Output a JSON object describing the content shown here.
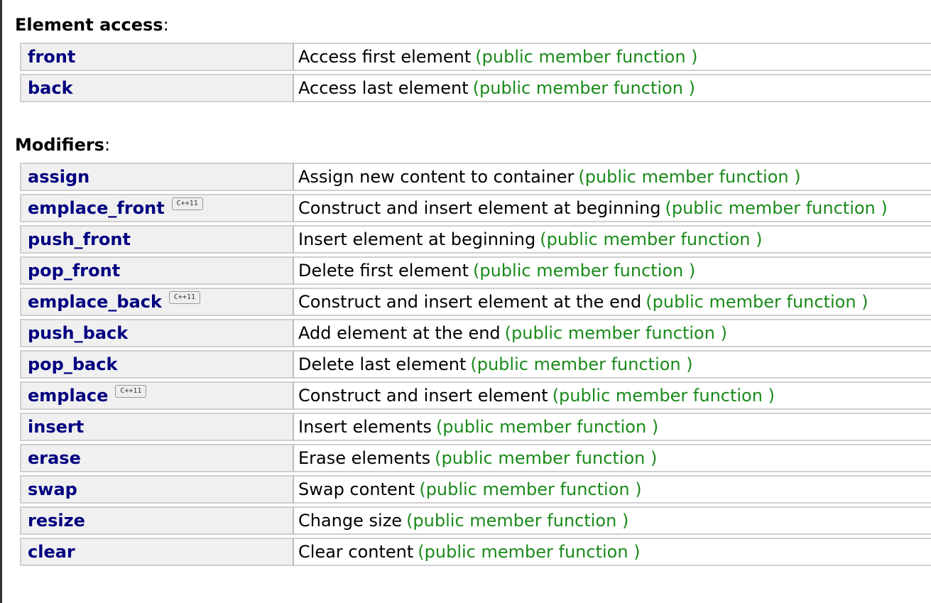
{
  "sections": [
    {
      "title": "Element access",
      "colon": ":",
      "rows": [
        {
          "name": "front",
          "description": "Access first element",
          "kind": "(public member function )",
          "badge": ""
        },
        {
          "name": "back",
          "description": "Access last element",
          "kind": "(public member function )",
          "badge": ""
        }
      ]
    },
    {
      "title": "Modifiers",
      "colon": ":",
      "rows": [
        {
          "name": "assign",
          "description": "Assign new content to container",
          "kind": "(public member function )",
          "badge": ""
        },
        {
          "name": "emplace_front",
          "description": "Construct and insert element at beginning",
          "kind": "(public member function )",
          "badge": "C++11"
        },
        {
          "name": "push_front",
          "description": "Insert element at beginning",
          "kind": "(public member function )",
          "badge": ""
        },
        {
          "name": "pop_front",
          "description": "Delete first element",
          "kind": "(public member function )",
          "badge": ""
        },
        {
          "name": "emplace_back",
          "description": "Construct and insert element at the end",
          "kind": "(public member function )",
          "badge": "C++11"
        },
        {
          "name": "push_back",
          "description": "Add element at the end",
          "kind": "(public member function )",
          "badge": ""
        },
        {
          "name": "pop_back",
          "description": "Delete last element",
          "kind": "(public member function )",
          "badge": ""
        },
        {
          "name": "emplace",
          "description": "Construct and insert element",
          "kind": "(public member function )",
          "badge": "C++11"
        },
        {
          "name": "insert",
          "description": "Insert elements",
          "kind": "(public member function )",
          "badge": ""
        },
        {
          "name": "erase",
          "description": "Erase elements",
          "kind": "(public member function )",
          "badge": ""
        },
        {
          "name": "swap",
          "description": "Swap content",
          "kind": "(public member function )",
          "badge": ""
        },
        {
          "name": "resize",
          "description": "Change size",
          "kind": "(public member function )",
          "badge": ""
        },
        {
          "name": "clear",
          "description": "Clear content",
          "kind": "(public member function )",
          "badge": ""
        }
      ]
    }
  ],
  "colors": {
    "member_name": "#000080",
    "kind": "#1a8a1a",
    "name_cell_bg": "#f0f0f0"
  }
}
